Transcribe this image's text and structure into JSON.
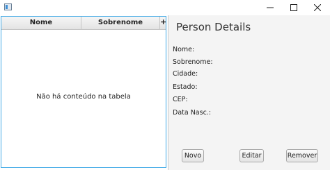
{
  "window": {
    "icons": {
      "app": "app-icon",
      "minimize": "minimize-icon",
      "maximize": "maximize-icon",
      "close": "close-icon"
    }
  },
  "table": {
    "columns": [
      "Nome",
      "Sobrenome"
    ],
    "column_menu_glyph": "+",
    "empty_text": "Não há conteúdo na tabela"
  },
  "details": {
    "title": "Person Details",
    "labels": [
      "Nome:",
      "Sobrenome:",
      "Cidade:",
      "Estado:",
      "CEP:",
      "Data Nasc.:"
    ]
  },
  "buttons": {
    "novo": "Novo",
    "editar": "Editar",
    "remover": "Remover"
  },
  "colors": {
    "focus_border": "#3fa9e6",
    "details_background": "#f4f4f4"
  }
}
